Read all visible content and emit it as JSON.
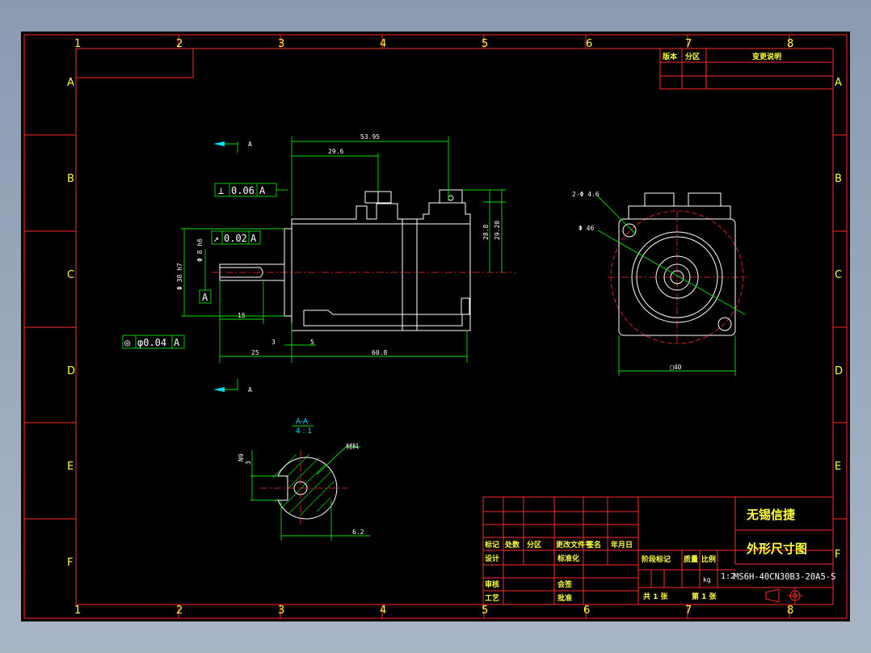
{
  "grid": {
    "columns": [
      "1",
      "2",
      "3",
      "4",
      "5",
      "6",
      "7",
      "8"
    ],
    "rows": [
      "A",
      "B",
      "C",
      "D",
      "E",
      "F"
    ]
  },
  "revision_table": {
    "headers": [
      "版本",
      "分区",
      "变更说明"
    ]
  },
  "front_view": {
    "section_marker": "A",
    "dimensions": {
      "overall_top": "53.95",
      "upper_span": "29.6",
      "height_a": "28.8",
      "height_b": "29.20",
      "key_len": "15",
      "shaft_len": "25",
      "flange_gap": "3",
      "flange_thk": "5",
      "body_len": "60.8",
      "shaft_dia": "Φ 8 h6",
      "spigot_dia": "Φ 30 h7"
    },
    "tolerances": {
      "perp_symbol": "⊥",
      "perp_value": "0.06",
      "perp_datum": "A",
      "runout_symbol": "↗",
      "runout_value": "0.02",
      "runout_datum": "A",
      "datum_label": "A",
      "coax_symbol": "◎",
      "coax_value": "φ0.04",
      "coax_datum": "A"
    }
  },
  "side_view": {
    "holes_label": "2-Φ 4.6",
    "pcd_label": "Φ 46",
    "square_label": "□40"
  },
  "section_view": {
    "title": "A-A",
    "scale": "4 : 1",
    "width_label": "N9",
    "width_value": "3",
    "depth_value": "6.2",
    "hatch_label": "材料"
  },
  "title_block": {
    "company": "无锡信捷",
    "drawing_title": "外形尺寸图",
    "model": "MS6H-40CN30B3-20A5-S",
    "scale": "1:2",
    "weight_unit": "kg",
    "headers_row": [
      "标记",
      "处数",
      "分区",
      "更改文件号",
      "签名",
      "年月日"
    ],
    "left_labels": [
      "设计",
      "",
      "审核",
      "工艺"
    ],
    "mid_labels": [
      "标准化",
      "",
      "会签",
      "批准"
    ],
    "stage_headers": [
      "阶段标记",
      "质量",
      "比例"
    ],
    "sheet_total": "共 1 张",
    "sheet_no": "第 1 张"
  },
  "colors": {
    "frame": "#ff2a2a",
    "dimension": "#00e000",
    "outline": "#ffffff",
    "text": "#ffff40",
    "background": "#000000"
  }
}
